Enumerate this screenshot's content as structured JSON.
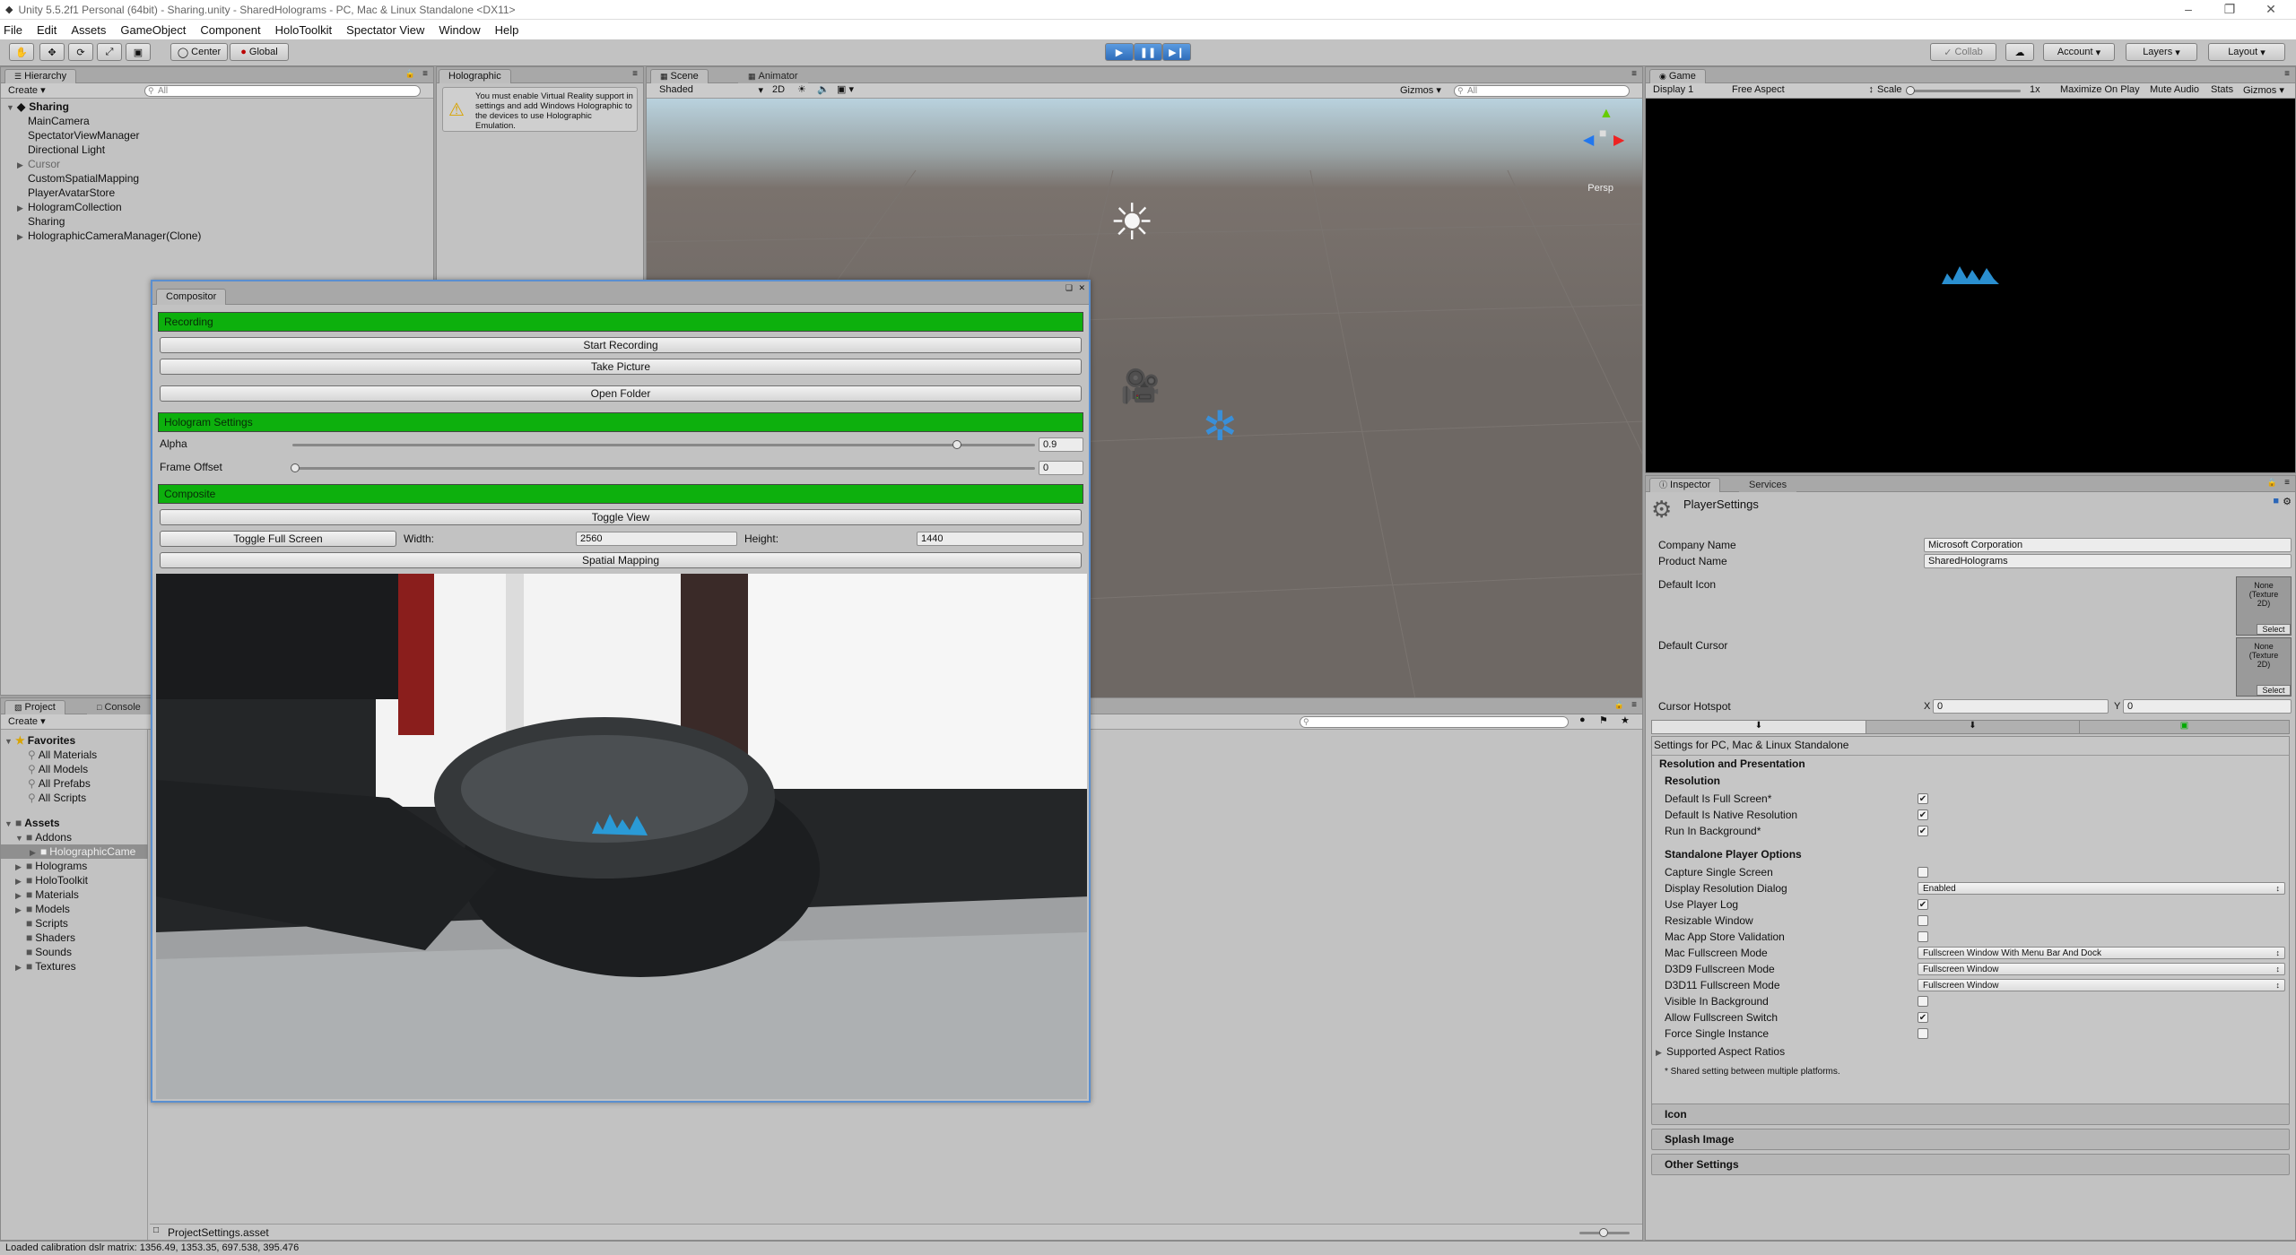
{
  "window": {
    "title": "Unity 5.5.2f1 Personal (64bit) - Sharing.unity - SharedHolograms - PC, Mac & Linux Standalone <DX11>"
  },
  "menu": [
    "File",
    "Edit",
    "Assets",
    "GameObject",
    "Component",
    "HoloToolkit",
    "Spectator View",
    "Window",
    "Help"
  ],
  "toolbar": {
    "center": "Center",
    "global": "Global",
    "collab": "Collab",
    "account": "Account",
    "layers": "Layers",
    "layout": "Layout"
  },
  "hierarchy": {
    "tab": "Hierarchy",
    "create": "Create",
    "search": "All",
    "scene": "Sharing",
    "items": [
      "MainCamera",
      "SpectatorViewManager",
      "Directional Light",
      "Cursor",
      "CustomSpatialMapping",
      "PlayerAvatarStore",
      "HologramCollection",
      "Sharing",
      "HolographicCameraManager(Clone)"
    ]
  },
  "holographic": {
    "tab": "Holographic",
    "warning": "You must enable Virtual Reality support in settings and add Windows Holographic to the devices to use Holographic Emulation."
  },
  "scene": {
    "tab": "Scene",
    "tab2": "Animator",
    "shading": "Shaded",
    "mode2d": "2D",
    "gizmos": "Gizmos",
    "search": "All",
    "persp": "Persp"
  },
  "game": {
    "tab": "Game",
    "display": "Display 1",
    "aspect": "Free Aspect",
    "scale_label": "Scale",
    "scale_value": "1x",
    "maximize": "Maximize On Play",
    "mute": "Mute Audio",
    "stats": "Stats",
    "gizmos": "Gizmos"
  },
  "compositor": {
    "title": "Compositor",
    "recording": "Recording",
    "start_recording": "Start Recording",
    "take_picture": "Take Picture",
    "open_folder": "Open Folder",
    "hologram_settings": "Hologram Settings",
    "alpha_label": "Alpha",
    "alpha_value": "0.9",
    "frame_offset_label": "Frame Offset",
    "frame_offset_value": "0",
    "composite": "Composite",
    "toggle_view": "Toggle View",
    "toggle_full_screen": "Toggle Full Screen",
    "width_label": "Width:",
    "width_value": "2560",
    "height_label": "Height:",
    "height_value": "1440",
    "spatial_mapping": "Spatial Mapping"
  },
  "project": {
    "tab": "Project",
    "tab2": "Console",
    "create": "Create",
    "favorites": "Favorites",
    "fav_items": [
      "All Materials",
      "All Models",
      "All Prefabs",
      "All Scripts"
    ],
    "assets": "Assets",
    "addons": "Addons",
    "addons_child": "HolographicCame",
    "asset_items": [
      "Holograms",
      "HoloToolkit",
      "Materials",
      "Models",
      "Scripts",
      "Shaders",
      "Sounds",
      "Textures"
    ],
    "selected_file": "ProjectSettings.asset"
  },
  "inspector": {
    "tab": "Inspector",
    "tab2": "Services",
    "header": "PlayerSettings",
    "company_label": "Company Name",
    "company_value": "Microsoft Corporation",
    "product_label": "Product Name",
    "product_value": "SharedHolograms",
    "default_icon": "Default Icon",
    "default_cursor": "Default Cursor",
    "texture_none": "None (Texture 2D)",
    "select": "Select",
    "hotspot": "Cursor Hotspot",
    "hotspot_x_label": "X",
    "hotspot_x": "0",
    "hotspot_y_label": "Y",
    "hotspot_y": "0",
    "platform_settings": "Settings for PC, Mac & Linux Standalone",
    "res_section": "Resolution and Presentation",
    "res_header": "Resolution",
    "res_rows": [
      {
        "label": "Default Is Full Screen*",
        "checked": true
      },
      {
        "label": "Default Is Native Resolution",
        "checked": true
      },
      {
        "label": "Run In Background*",
        "checked": true
      }
    ],
    "standalone_header": "Standalone Player Options",
    "standalone_rows": [
      {
        "label": "Capture Single Screen",
        "type": "check",
        "checked": false
      },
      {
        "label": "Display Resolution Dialog",
        "type": "drop",
        "value": "Enabled"
      },
      {
        "label": "Use Player Log",
        "type": "check",
        "checked": true
      },
      {
        "label": "Resizable Window",
        "type": "check",
        "checked": false
      },
      {
        "label": "Mac App Store Validation",
        "type": "check",
        "checked": false
      },
      {
        "label": "Mac Fullscreen Mode",
        "type": "drop",
        "value": "Fullscreen Window With Menu Bar And Dock"
      },
      {
        "label": "D3D9 Fullscreen Mode",
        "type": "drop",
        "value": "Fullscreen Window"
      },
      {
        "label": "D3D11 Fullscreen Mode",
        "type": "drop",
        "value": "Fullscreen Window"
      },
      {
        "label": "Visible In Background",
        "type": "check",
        "checked": false
      },
      {
        "label": "Allow Fullscreen Switch",
        "type": "check",
        "checked": true
      },
      {
        "label": "Force Single Instance",
        "type": "check",
        "checked": false
      }
    ],
    "aspect_ratios": "Supported Aspect Ratios",
    "shared_note": "* Shared setting between multiple platforms.",
    "foldouts": [
      "Icon",
      "Splash Image",
      "Other Settings"
    ]
  },
  "status": {
    "message": "Loaded calibration dslr matrix: 1356.49, 1353.35, 697.538, 395.476"
  }
}
